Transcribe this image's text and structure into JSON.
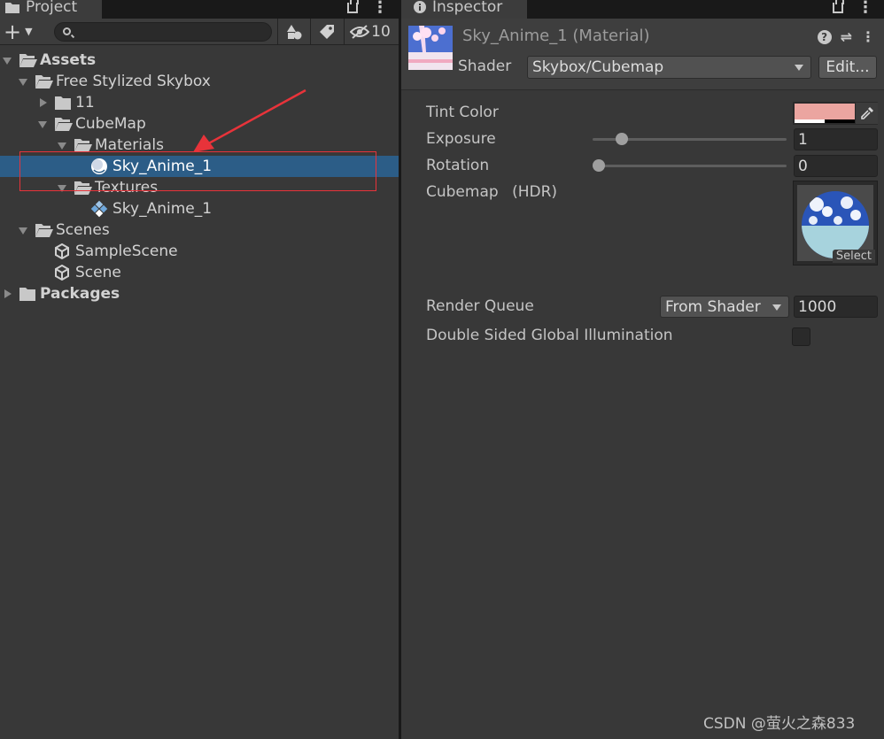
{
  "project_panel": {
    "tab_label": "Project",
    "hidden_count": "10",
    "search": {
      "placeholder": ""
    },
    "tree": [
      {
        "label": "Assets",
        "depth": 0,
        "icon": "folder-open-icon",
        "expanded": true,
        "bold": true
      },
      {
        "label": "Free Stylized Skybox",
        "depth": 1,
        "icon": "folder-open-icon",
        "expanded": true
      },
      {
        "label": "11",
        "depth": 2,
        "icon": "folder-icon",
        "expanded": false
      },
      {
        "label": "CubeMap",
        "depth": 2,
        "icon": "folder-open-icon",
        "expanded": true
      },
      {
        "label": "Materials",
        "depth": 3,
        "icon": "folder-open-icon",
        "expanded": true
      },
      {
        "label": "Sky_Anime_1",
        "depth": 4,
        "icon": "material-sphere-icon",
        "selected": true
      },
      {
        "label": "Textures",
        "depth": 3,
        "icon": "folder-open-icon",
        "expanded": true
      },
      {
        "label": "Sky_Anime_1",
        "depth": 4,
        "icon": "texture-icon"
      },
      {
        "label": "Scenes",
        "depth": 1,
        "icon": "folder-open-icon",
        "expanded": true
      },
      {
        "label": "SampleScene",
        "depth": 2,
        "icon": "unity-scene-icon"
      },
      {
        "label": "Scene",
        "depth": 2,
        "icon": "unity-scene-icon"
      },
      {
        "label": "Packages",
        "depth": 0,
        "icon": "folder-icon",
        "expanded": false,
        "bold": true
      }
    ]
  },
  "inspector": {
    "tab_label": "Inspector",
    "material_title": "Sky_Anime_1 (Material)",
    "shader_label": "Shader",
    "shader_value": "Skybox/Cubemap",
    "edit_button": "Edit...",
    "properties": {
      "tint_label": "Tint Color",
      "tint_color": "#eba5a0",
      "exposure_label": "Exposure",
      "exposure_value": "1",
      "rotation_label": "Rotation",
      "rotation_value": "0",
      "cubemap_label": "Cubemap",
      "cubemap_hdr": "(HDR)",
      "select_label": "Select"
    },
    "render_queue_label": "Render Queue",
    "render_queue_mode": "From Shader",
    "render_queue_value": "1000",
    "dsgi_label": "Double Sided Global Illumination",
    "dsgi_checked": false
  },
  "annotation": {
    "color": "#e8333a"
  },
  "watermark": "CSDN @萤火之森833"
}
